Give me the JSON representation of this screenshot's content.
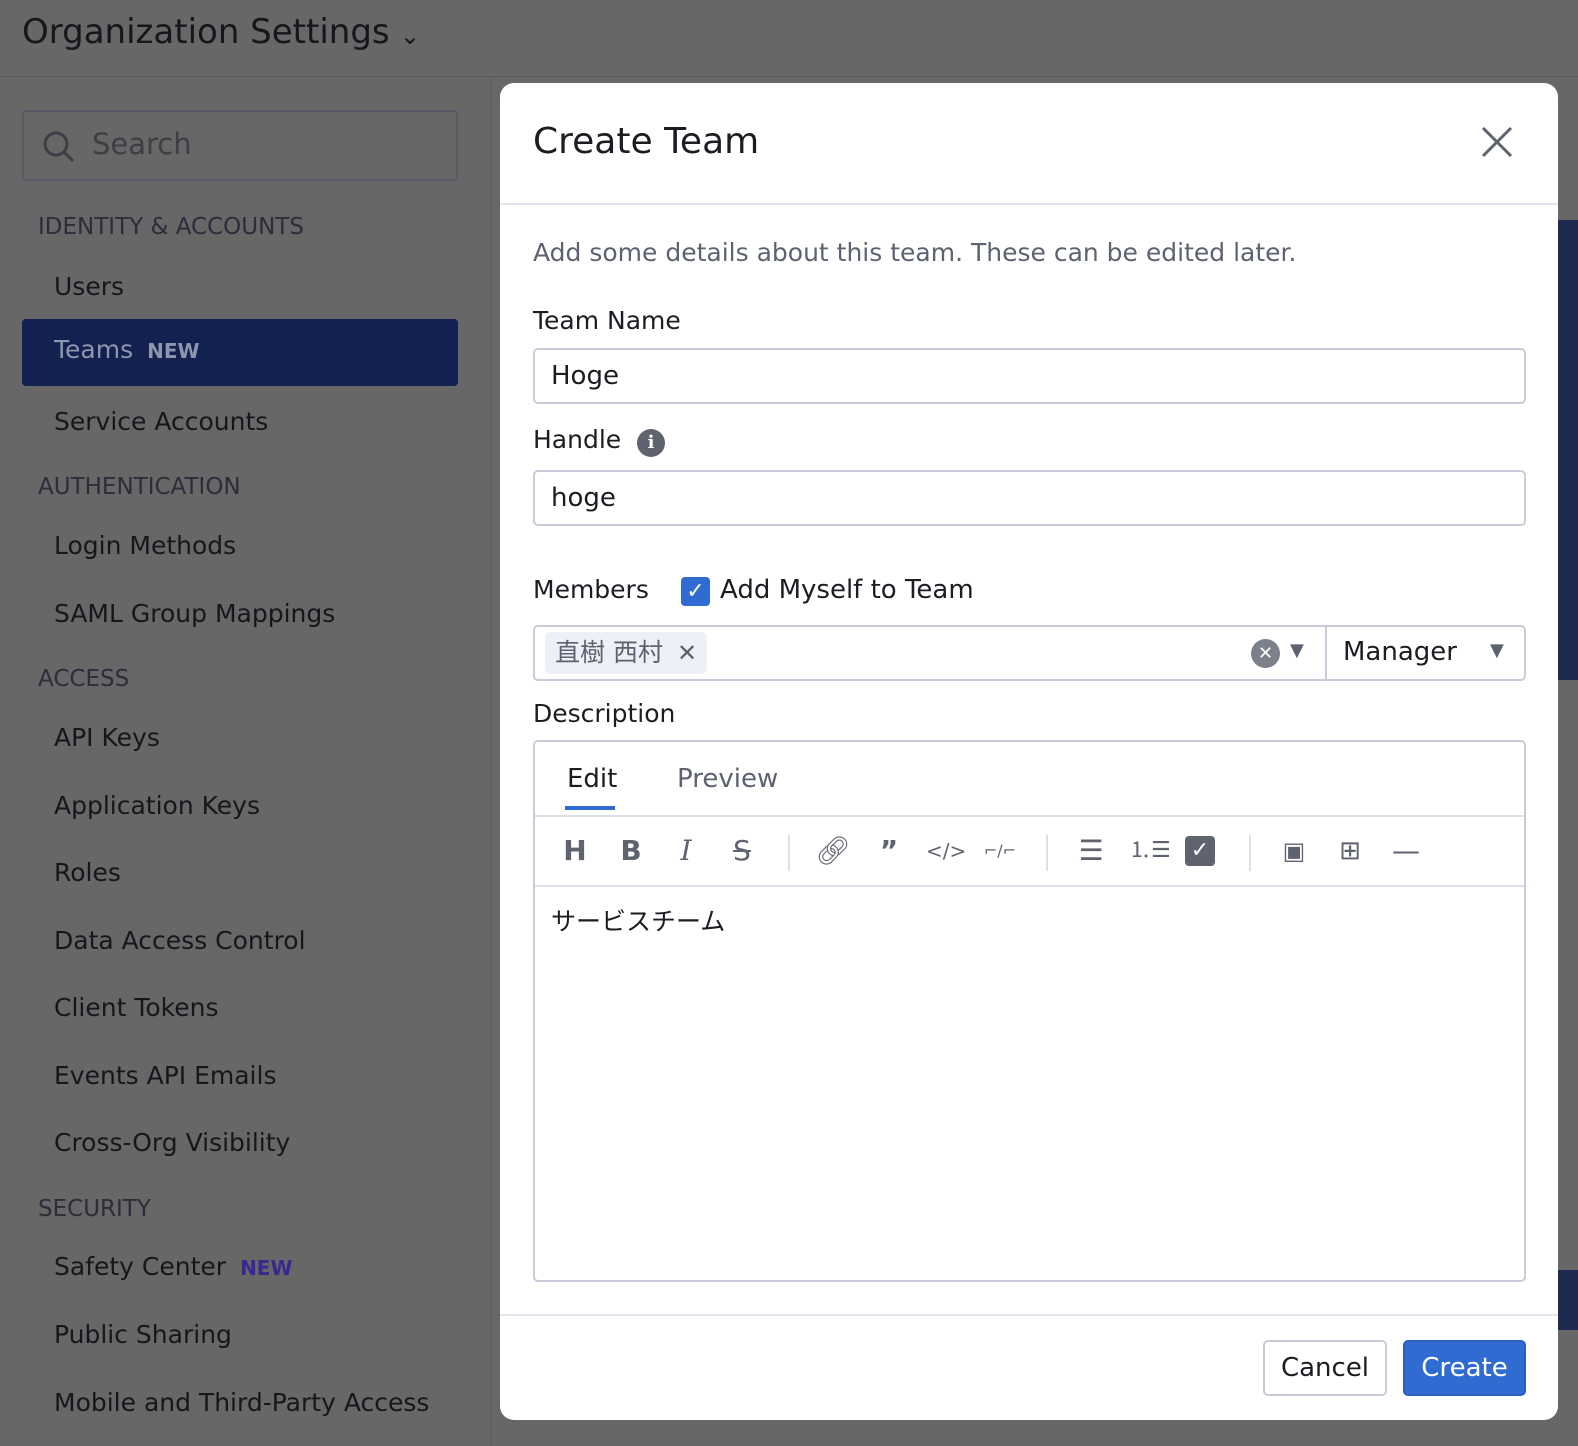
{
  "header": {
    "title": "Organization Settings"
  },
  "sidebar": {
    "search_placeholder": "Search",
    "sections": [
      {
        "title": "IDENTITY & ACCOUNTS",
        "items": [
          "Users",
          "Teams",
          "Service Accounts"
        ]
      },
      {
        "title": "AUTHENTICATION",
        "items": [
          "Login Methods",
          "SAML Group Mappings"
        ]
      },
      {
        "title": "ACCESS",
        "items": [
          "API Keys",
          "Application Keys",
          "Roles",
          "Data Access Control",
          "Client Tokens",
          "Events API Emails",
          "Cross-Org Visibility"
        ]
      },
      {
        "title": "SECURITY",
        "items": [
          "Safety Center",
          "Public Sharing",
          "Mobile and Third-Party Access"
        ]
      }
    ],
    "new_badge": "NEW"
  },
  "modal": {
    "title": "Create Team",
    "intro": "Add some details about this team. These can be edited later.",
    "team_name_label": "Team Name",
    "team_name_value": "Hoge",
    "handle_label": "Handle",
    "handle_value": "hoge",
    "members_label": "Members",
    "add_myself_label": "Add Myself to Team",
    "add_myself_checked": true,
    "member_chip": "直樹 西村",
    "role_value": "Manager",
    "description_label": "Description",
    "tab_edit": "Edit",
    "tab_preview": "Preview",
    "description_value": "サービスチーム",
    "cancel": "Cancel",
    "create": "Create"
  }
}
